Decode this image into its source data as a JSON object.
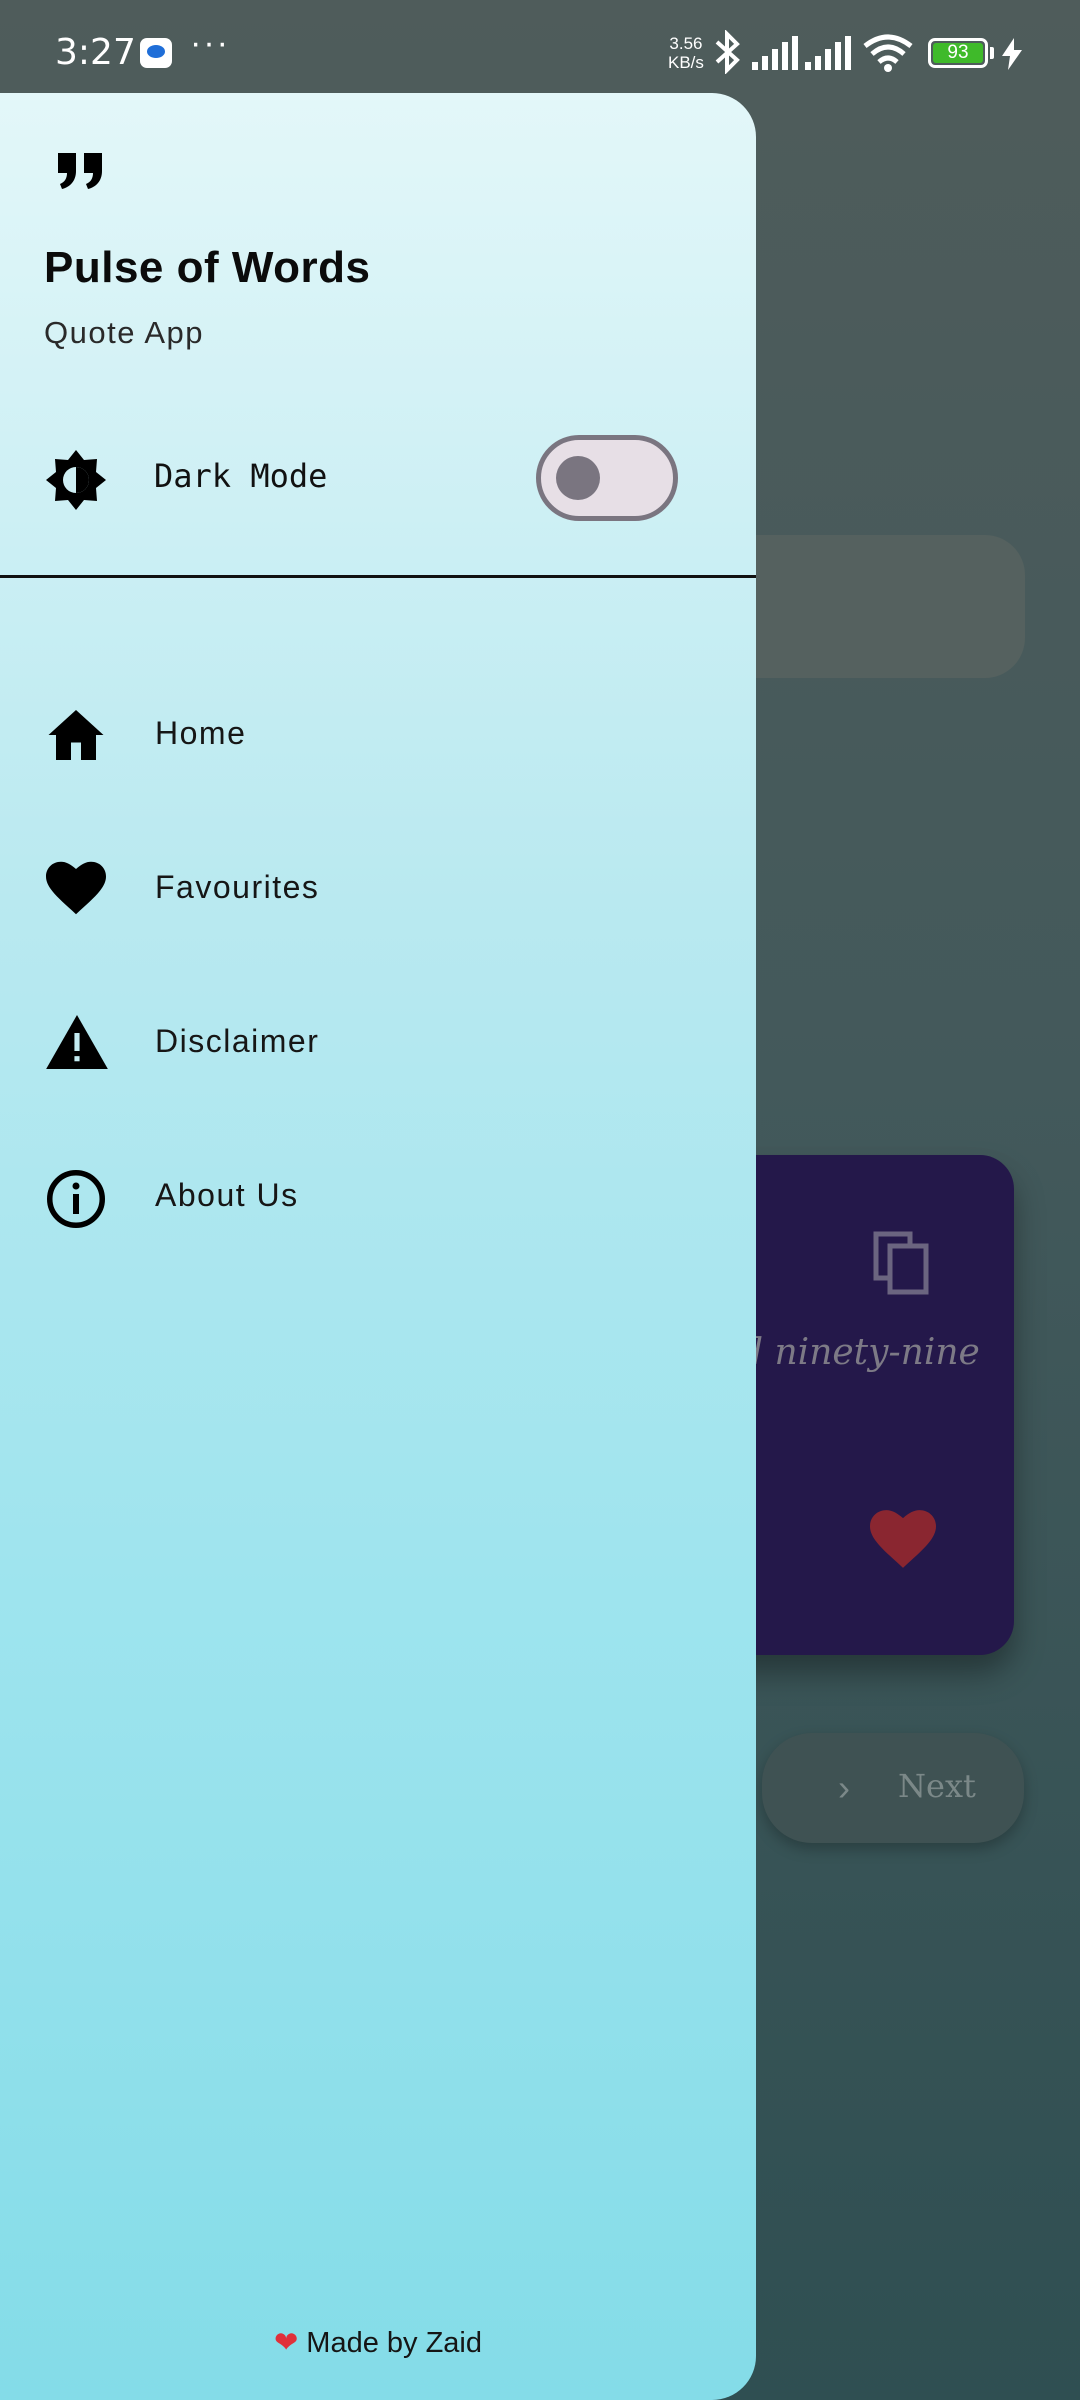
{
  "status_bar": {
    "time": "3:27",
    "net_speed_value": "3.56",
    "net_speed_unit": "KB/s",
    "battery": "93"
  },
  "background": {
    "quote_fragment": "d ninety-nine",
    "next_label": "Next"
  },
  "drawer": {
    "app_title": "Pulse of Words",
    "app_subtitle": "Quote App",
    "dark_mode_label": "Dark Mode",
    "dark_mode_on": false,
    "items": [
      {
        "label": "Home",
        "icon": "home-icon"
      },
      {
        "label": "Favourites",
        "icon": "heart-icon"
      },
      {
        "label": "Disclaimer",
        "icon": "warning-icon"
      },
      {
        "label": "About Us",
        "icon": "info-icon"
      }
    ],
    "footer_text": "Made by Zaid"
  },
  "colors": {
    "drawer_top": "#e3f7f9",
    "drawer_bottom": "#84dce8",
    "card": "#24184a",
    "heart": "#e0303a"
  }
}
